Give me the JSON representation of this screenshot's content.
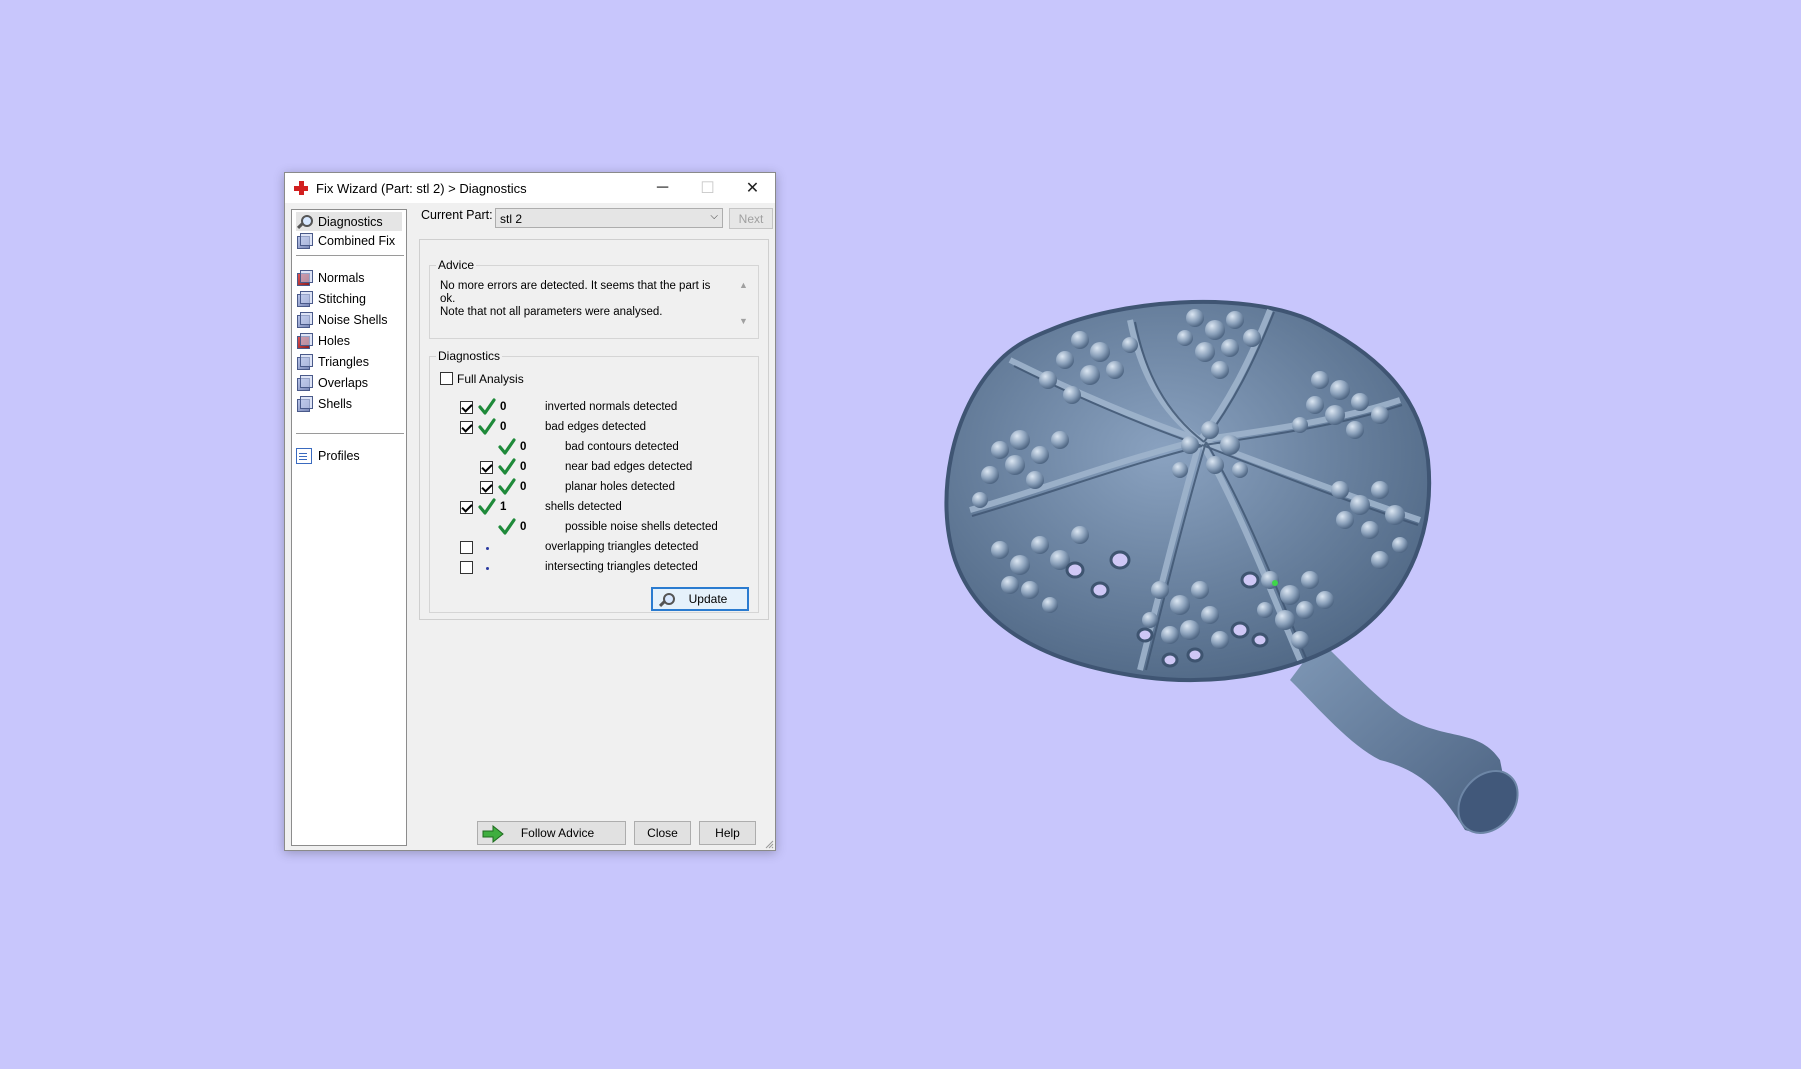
{
  "window": {
    "title": "Fix Wizard (Part: stl 2) > Diagnostics",
    "minimize": "─",
    "maximize": "☐",
    "close": "✕"
  },
  "nav": {
    "items": [
      {
        "label": "Diagnostics",
        "icon": "magnifier-icon",
        "selected": true
      },
      {
        "label": "Combined Fix",
        "icon": "cube-icon"
      },
      {
        "label": "Normals",
        "icon": "normals-cube-icon"
      },
      {
        "label": "Stitching",
        "icon": "stitching-cube-icon"
      },
      {
        "label": "Noise Shells",
        "icon": "noise-shells-icon"
      },
      {
        "label": "Holes",
        "icon": "holes-cube-icon"
      },
      {
        "label": "Triangles",
        "icon": "triangles-cube-icon"
      },
      {
        "label": "Overlaps",
        "icon": "overlaps-cube-icon"
      },
      {
        "label": "Shells",
        "icon": "shells-cube-icon"
      },
      {
        "label": "Profiles",
        "icon": "document-icon"
      }
    ]
  },
  "top": {
    "current_part_label": "Current Part:",
    "current_part_value": "stl 2",
    "next_label": "Next"
  },
  "advice": {
    "title": "Advice",
    "text_line1": "No more errors are detected. It seems that the part is ok.",
    "text_line2": "Note that not all parameters were analysed."
  },
  "diagnostics": {
    "title": "Diagnostics",
    "full_analysis_label": "Full Analysis",
    "full_analysis_checked": false,
    "rows": [
      {
        "count": "0",
        "label": "inverted normals detected",
        "checked": true,
        "status": "ok"
      },
      {
        "count": "0",
        "label": "bad edges detected",
        "checked": true,
        "status": "ok"
      },
      {
        "count": "0",
        "label": "bad contours detected",
        "checked": null,
        "status": "ok"
      },
      {
        "count": "0",
        "label": "near bad edges detected",
        "checked": true,
        "status": "ok"
      },
      {
        "count": "0",
        "label": "planar holes detected",
        "checked": true,
        "status": "ok"
      },
      {
        "count": "1",
        "label": "shells detected",
        "checked": true,
        "status": "ok"
      },
      {
        "count": "0",
        "label": "possible noise shells detected",
        "checked": null,
        "status": "ok"
      },
      {
        "count": "",
        "label": "overlapping triangles detected",
        "checked": false,
        "status": "not-run"
      },
      {
        "count": "",
        "label": "intersecting triangles detected",
        "checked": false,
        "status": "not-run"
      }
    ],
    "update_label": "Update"
  },
  "footer": {
    "follow_advice_label": "Follow Advice",
    "close_label": "Close",
    "help_label": "Help"
  },
  "colors": {
    "background": "#c8c6fc",
    "check_green": "#1f8a3a",
    "model_blue": "#6f8aa8"
  }
}
